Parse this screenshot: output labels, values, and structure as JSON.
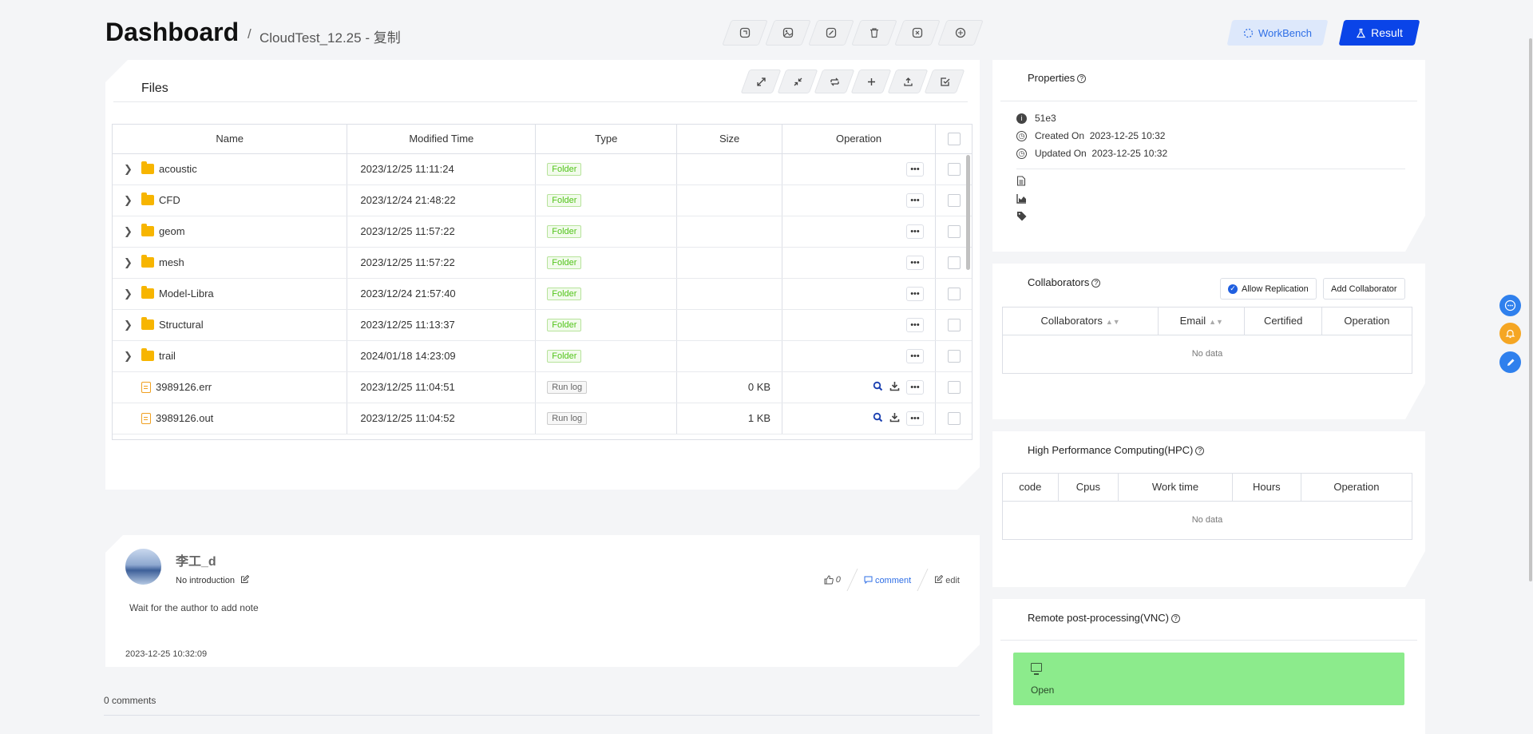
{
  "header": {
    "title": "Dashboard",
    "separator": "/",
    "crumb": "CloudTest_12.25 - 复制",
    "tools": [
      "copy-icon",
      "image-icon",
      "edit-icon",
      "delete-icon",
      "close-icon",
      "share-icon"
    ],
    "workbench_label": "WorkBench",
    "result_label": "Result"
  },
  "files": {
    "title": "Files",
    "tools": [
      "expand-icon",
      "collapse-icon",
      "refresh-icon",
      "plus-icon",
      "upload-icon",
      "select-icon"
    ],
    "columns": [
      "Name",
      "Modified Time",
      "Type",
      "Size",
      "Operation"
    ],
    "rows": [
      {
        "name": "acoustic",
        "time": "2023/12/25 11:11:24",
        "type": "Folder",
        "size": "",
        "kind": "folder"
      },
      {
        "name": "CFD",
        "time": "2023/12/24 21:48:22",
        "type": "Folder",
        "size": "",
        "kind": "folder"
      },
      {
        "name": "geom",
        "time": "2023/12/25 11:57:22",
        "type": "Folder",
        "size": "",
        "kind": "folder"
      },
      {
        "name": "mesh",
        "time": "2023/12/25 11:57:22",
        "type": "Folder",
        "size": "",
        "kind": "folder"
      },
      {
        "name": "Model-Libra",
        "time": "2023/12/24 21:57:40",
        "type": "Folder",
        "size": "",
        "kind": "folder"
      },
      {
        "name": "Structural",
        "time": "2023/12/25 11:13:37",
        "type": "Folder",
        "size": "",
        "kind": "folder"
      },
      {
        "name": "trail",
        "time": "2024/01/18 14:23:09",
        "type": "Folder",
        "size": "",
        "kind": "folder"
      },
      {
        "name": "3989126.err",
        "time": "2023/12/25 11:04:51",
        "type": "Run log",
        "size": "0 KB",
        "kind": "file"
      },
      {
        "name": "3989126.out",
        "time": "2023/12/25 11:04:52",
        "type": "Run log",
        "size": "1 KB",
        "kind": "file"
      }
    ]
  },
  "note": {
    "author": "李工_d",
    "intro": "No introduction",
    "text": "Wait for the author to add note",
    "date": "2023-12-25 10:32:09",
    "likes": "0",
    "comment_label": "comment",
    "edit_label": "edit",
    "comments_count": "0 comments"
  },
  "properties": {
    "title": "Properties",
    "id": "51e3",
    "created_label": "Created On",
    "created_value": "2023-12-25 10:32",
    "updated_label": "Updated On",
    "updated_value": "2023-12-25 10:32"
  },
  "collaborators": {
    "title": "Collaborators",
    "allow_label": "Allow Replication",
    "add_label": "Add Collaborator",
    "columns": [
      "Collaborators",
      "Email",
      "Certified",
      "Operation"
    ],
    "empty": "No data"
  },
  "hpc": {
    "title": "High Performance Computing(HPC)",
    "columns": [
      "code",
      "Cpus",
      "Work time",
      "Hours",
      "Operation"
    ],
    "empty": "No data"
  },
  "vnc": {
    "title": "Remote post-processing(VNC)",
    "open_label": "Open"
  },
  "colors": {
    "accent": "#0a44e8",
    "folder": "#f7b500",
    "vnc": "#8ceb8c"
  }
}
